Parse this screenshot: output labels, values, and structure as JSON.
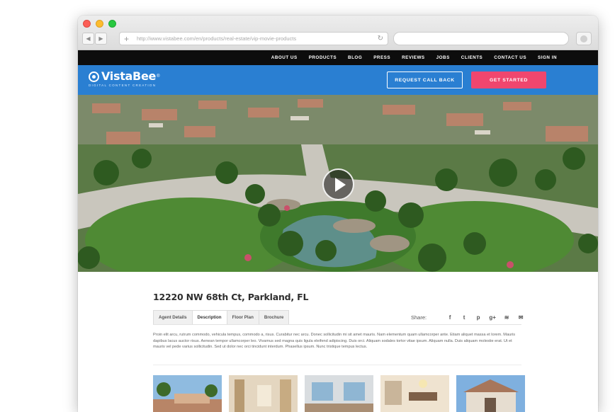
{
  "browser": {
    "url": "http://www.vistabee.com/en/products/real-estate/vip-movie-products",
    "back_glyph": "◀",
    "forward_glyph": "▶",
    "plus_glyph": "+",
    "reload_glyph": "↻"
  },
  "topnav": {
    "items": [
      "ABOUT US",
      "PRODUCTS",
      "BLOG",
      "PRESS",
      "REVIEWS",
      "JOBS",
      "CLIENTS",
      "CONTACT US",
      "SIGN IN"
    ]
  },
  "header": {
    "brand": "VistaBee",
    "registered": "®",
    "tagline": "DIGITAL CONTENT CREATION",
    "callback_label": "REQUEST CALL BACK",
    "started_label": "GET STARTED",
    "colors": {
      "header_bg": "#2a7fd2",
      "cta_bg": "#f0466e"
    }
  },
  "property": {
    "title": "12220 NW 68th Ct, Parkland, FL",
    "tabs": [
      "Agent Details",
      "Description",
      "Floor Plan",
      "Brochure"
    ],
    "active_tab": "Description",
    "share_label": "Share:",
    "share_icons": [
      {
        "name": "facebook-icon",
        "glyph": "f"
      },
      {
        "name": "twitter-icon",
        "glyph": "t"
      },
      {
        "name": "pinterest-icon",
        "glyph": "p"
      },
      {
        "name": "google-plus-icon",
        "glyph": "g+"
      },
      {
        "name": "rss-icon",
        "glyph": "≋"
      },
      {
        "name": "email-icon",
        "glyph": "✉"
      }
    ],
    "description": "Proin elit arcu, rutrum commodo, vehicula tempus, commodo a, risus. Curabitur nec arcu. Donec sollicitudin mi sit amet mauris. Nam elementum quam ullamcorper ante. Etiam aliquet massa et lorem. Mauris dapibus lacus auctor risus. Aenean tempor ullamcorper leo. Vivamus sed magna quis ligula eleifend adipiscing. Duis orci. Aliquam sodales tortor vitae ipsum. Aliquam nulla. Duis aliquam molestie erat. Ut et mauris vel pede varius sollicitudin. Sed ut dolor nec orci tincidunt interdum. Phasellus ipsum. Nunc tristique tempus lectus."
  }
}
